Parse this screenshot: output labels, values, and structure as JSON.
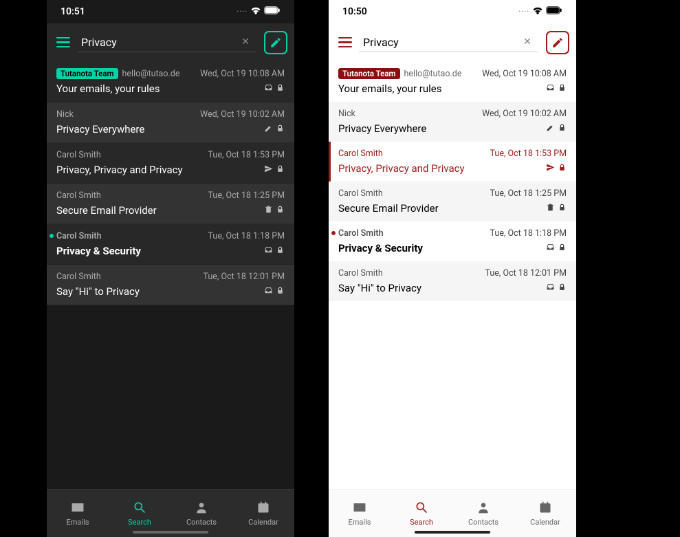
{
  "screens": [
    {
      "theme": "dark",
      "status": {
        "time": "10:51"
      },
      "search": {
        "value": "Privacy"
      },
      "selected_index": -1,
      "emails": [
        {
          "badge": "Tutanota Team",
          "sender": "",
          "extra": "hello@tutao.de",
          "date": "Wed, Oct 19 10:08 AM",
          "subject": "Your emails, your rules",
          "icons": [
            "inbox",
            "lock"
          ],
          "unread": false
        },
        {
          "sender": "Nick",
          "date": "Wed, Oct 19 10:02 AM",
          "subject": "Privacy Everywhere",
          "icons": [
            "draft",
            "lock"
          ],
          "unread": false
        },
        {
          "sender": "Carol Smith",
          "date": "Tue, Oct 18 1:53 PM",
          "subject": "Privacy, Privacy and Privacy",
          "icons": [
            "sent",
            "lock"
          ],
          "unread": false
        },
        {
          "sender": "Carol Smith",
          "date": "Tue, Oct 18 1:25 PM",
          "subject": "Secure Email Provider",
          "icons": [
            "trash",
            "lock"
          ],
          "unread": false
        },
        {
          "sender": "Carol Smith",
          "date": "Tue, Oct 18 1:18 PM",
          "subject": "Privacy & Security",
          "icons": [
            "inbox",
            "lock"
          ],
          "unread": true
        },
        {
          "sender": "Carol Smith",
          "date": "Tue, Oct 18 12:01 PM",
          "subject": "Say \"Hi\" to Privacy",
          "icons": [
            "inbox",
            "lock"
          ],
          "unread": false
        }
      ]
    },
    {
      "theme": "light",
      "status": {
        "time": "10:50"
      },
      "search": {
        "value": "Privacy"
      },
      "selected_index": 2,
      "emails": [
        {
          "badge": "Tutanota Team",
          "sender": "",
          "extra": "hello@tutao.de",
          "date": "Wed, Oct 19 10:08 AM",
          "subject": "Your emails, your rules",
          "icons": [
            "inbox",
            "lock"
          ],
          "unread": false
        },
        {
          "sender": "Nick",
          "date": "Wed, Oct 19 10:02 AM",
          "subject": "Privacy Everywhere",
          "icons": [
            "draft",
            "lock"
          ],
          "unread": false
        },
        {
          "sender": "Carol Smith",
          "date": "Tue, Oct 18 1:53 PM",
          "subject": "Privacy, Privacy and Privacy",
          "icons": [
            "sent",
            "lock"
          ],
          "unread": false
        },
        {
          "sender": "Carol Smith",
          "date": "Tue, Oct 18 1:25 PM",
          "subject": "Secure Email Provider",
          "icons": [
            "trash",
            "lock"
          ],
          "unread": false
        },
        {
          "sender": "Carol Smith",
          "date": "Tue, Oct 18 1:18 PM",
          "subject": "Privacy & Security",
          "icons": [
            "inbox",
            "lock"
          ],
          "unread": true
        },
        {
          "sender": "Carol Smith",
          "date": "Tue, Oct 18 12:01 PM",
          "subject": "Say \"Hi\" to Privacy",
          "icons": [
            "inbox",
            "lock"
          ],
          "unread": false
        }
      ]
    }
  ],
  "nav": {
    "items": [
      {
        "key": "emails",
        "label": "Emails",
        "icon": "mail"
      },
      {
        "key": "search",
        "label": "Search",
        "icon": "search"
      },
      {
        "key": "contacts",
        "label": "Contacts",
        "icon": "person"
      },
      {
        "key": "calendar",
        "label": "Calendar",
        "icon": "calendar"
      }
    ],
    "active": "search"
  }
}
